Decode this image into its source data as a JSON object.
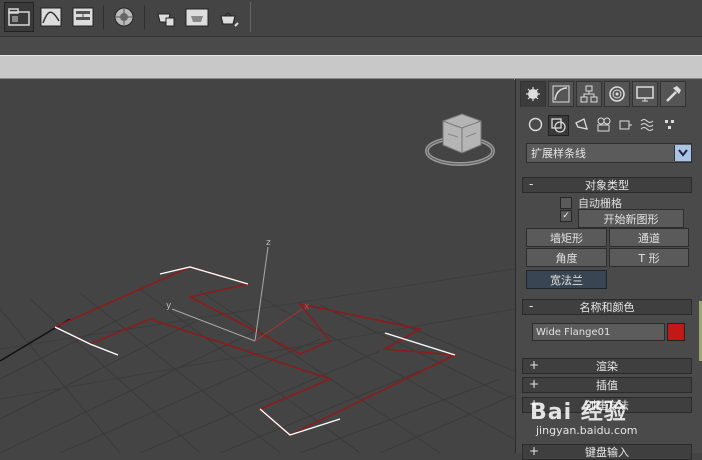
{
  "toolbar": {
    "icons": [
      "scene-explorer-icon",
      "curve-editor-icon",
      "schematic-view-icon",
      "material-editor-icon",
      "render-setup-icon",
      "rendered-frame-icon",
      "render-icon"
    ]
  },
  "viewport": {
    "axis_labels": {
      "z": "z",
      "y": "y",
      "x": "x"
    }
  },
  "panel": {
    "tabs": [
      "create-tab",
      "modify-tab",
      "hierarchy-tab",
      "motion-tab",
      "display-tab",
      "utilities-tab"
    ],
    "category_icons": [
      "geometry",
      "shapes",
      "lights",
      "cameras",
      "helpers",
      "space-warps",
      "systems"
    ],
    "dropdown_value": "扩展样条线",
    "object_type": {
      "title": "对象类型",
      "sign": "-",
      "auto_grid": "自动栅格",
      "start_new_shape": "开始新图形",
      "buttons": [
        "墙矩形",
        "通道",
        "角度",
        "T 形",
        "宽法兰"
      ]
    },
    "name_color": {
      "title": "名称和颜色",
      "sign": "-",
      "name_value": "Wide Flange01",
      "color": "#c21818"
    },
    "rollouts_collapsed": [
      {
        "sign": "+",
        "title": "渲染"
      },
      {
        "sign": "+",
        "title": "插值"
      },
      {
        "sign": "+",
        "title": "创建方法"
      },
      {
        "sign": "+",
        "title": "键盘输入"
      }
    ]
  },
  "watermark": {
    "brand": "Bai 经验",
    "url": "jingyan.baidu.com"
  }
}
